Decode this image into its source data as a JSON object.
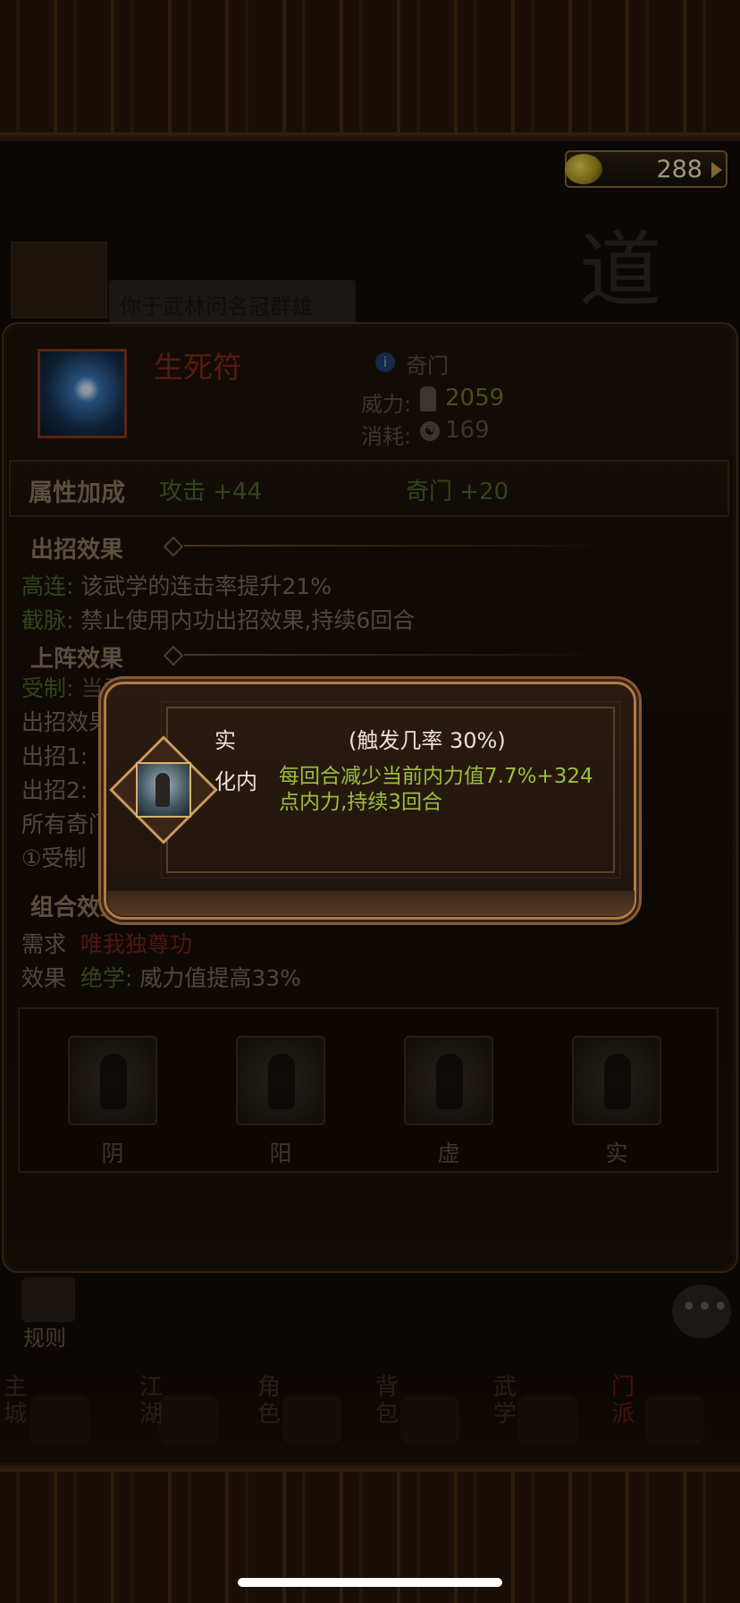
{
  "currency": {
    "value": "288",
    "icon": "coins-icon"
  },
  "background": {
    "banner_text": "你于武林问名冠群雄",
    "calligraphy": "道"
  },
  "skill": {
    "name": "生死符",
    "type": "奇门",
    "power_label": "威力:",
    "power_value": "2059",
    "cost_label": "消耗:",
    "cost_value": "169"
  },
  "attributes": {
    "title": "属性加成",
    "bonus_1": "攻击 +44",
    "bonus_2": "奇门 +20"
  },
  "attack_effects": {
    "title": "出招效果",
    "rows": [
      {
        "tag": "高连:",
        "text": "该武学的连击率提升21%"
      },
      {
        "tag": "截脉:",
        "text": "禁止使用内功出招效果,持续6回合"
      }
    ]
  },
  "battle_effects": {
    "title": "上阵效果",
    "rows": [
      {
        "tag": "受制:",
        "text": "当武学突破至150级后，激活以下效果："
      },
      {
        "tag": "",
        "text": "出招效果增"
      },
      {
        "tag": "",
        "text": "出招1:"
      },
      {
        "tag": "",
        "text": "出招2:"
      },
      {
        "tag": "",
        "text": "所有奇门"
      },
      {
        "tag": "",
        "text": "①受制"
      }
    ]
  },
  "combo_effects": {
    "title": "组合效果",
    "req_label": "需求",
    "req_value": "唯我独尊功",
    "effect_label": "效果",
    "effect_tag": "绝学:",
    "effect_value": "威力值提高33%"
  },
  "stances": [
    {
      "label": "阴"
    },
    {
      "label": "阳"
    },
    {
      "label": "虚"
    },
    {
      "label": "实"
    }
  ],
  "popup": {
    "stance": "实",
    "rate": "(触发几率 30%)",
    "effect_name": "化内",
    "effect_desc": "每回合减少当前内力值7.7%+324点内力,持续3回合"
  },
  "rules": {
    "label": "规则"
  },
  "nav": [
    {
      "label": "主城"
    },
    {
      "label": "江湖"
    },
    {
      "label": "角色"
    },
    {
      "label": "背包"
    },
    {
      "label": "武学"
    },
    {
      "label": "门派"
    }
  ],
  "colors": {
    "highlight_green": "#9bbf3c",
    "gold": "#c99a5c",
    "skill_red": "#8a2718"
  }
}
